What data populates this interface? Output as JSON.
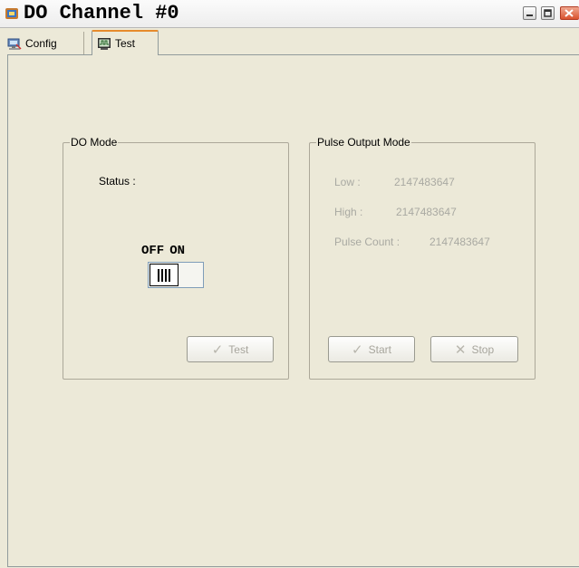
{
  "window": {
    "title": "DO Channel #0",
    "icons": {
      "app": "app-icon",
      "minimize": "minimize-icon",
      "maximize": "maximize-icon",
      "close": "close-icon"
    }
  },
  "tabs": [
    {
      "label": "Config",
      "icon": "config-icon",
      "selected": false
    },
    {
      "label": "Test",
      "icon": "test-icon",
      "selected": true
    }
  ],
  "do_mode": {
    "legend": "DO Mode",
    "status_label": "Status :",
    "off_label": "OFF",
    "on_label": "ON",
    "switch_state": "OFF",
    "test_button": "Test",
    "test_icon": "check-icon"
  },
  "pulse_mode": {
    "legend": "Pulse Output Mode",
    "low_label": "Low :",
    "low_value": "2147483647",
    "high_label": "High :",
    "high_value": "2147483647",
    "pulse_count_label": "Pulse Count :",
    "pulse_count_value": "2147483647",
    "start_button": "Start",
    "start_icon": "check-icon",
    "stop_button": "Stop",
    "stop_icon": "stop-cross-icon"
  },
  "colors": {
    "background": "#ece9d8",
    "disabled_text": "#a9a9a2",
    "tab_accent": "#e68b2c"
  }
}
